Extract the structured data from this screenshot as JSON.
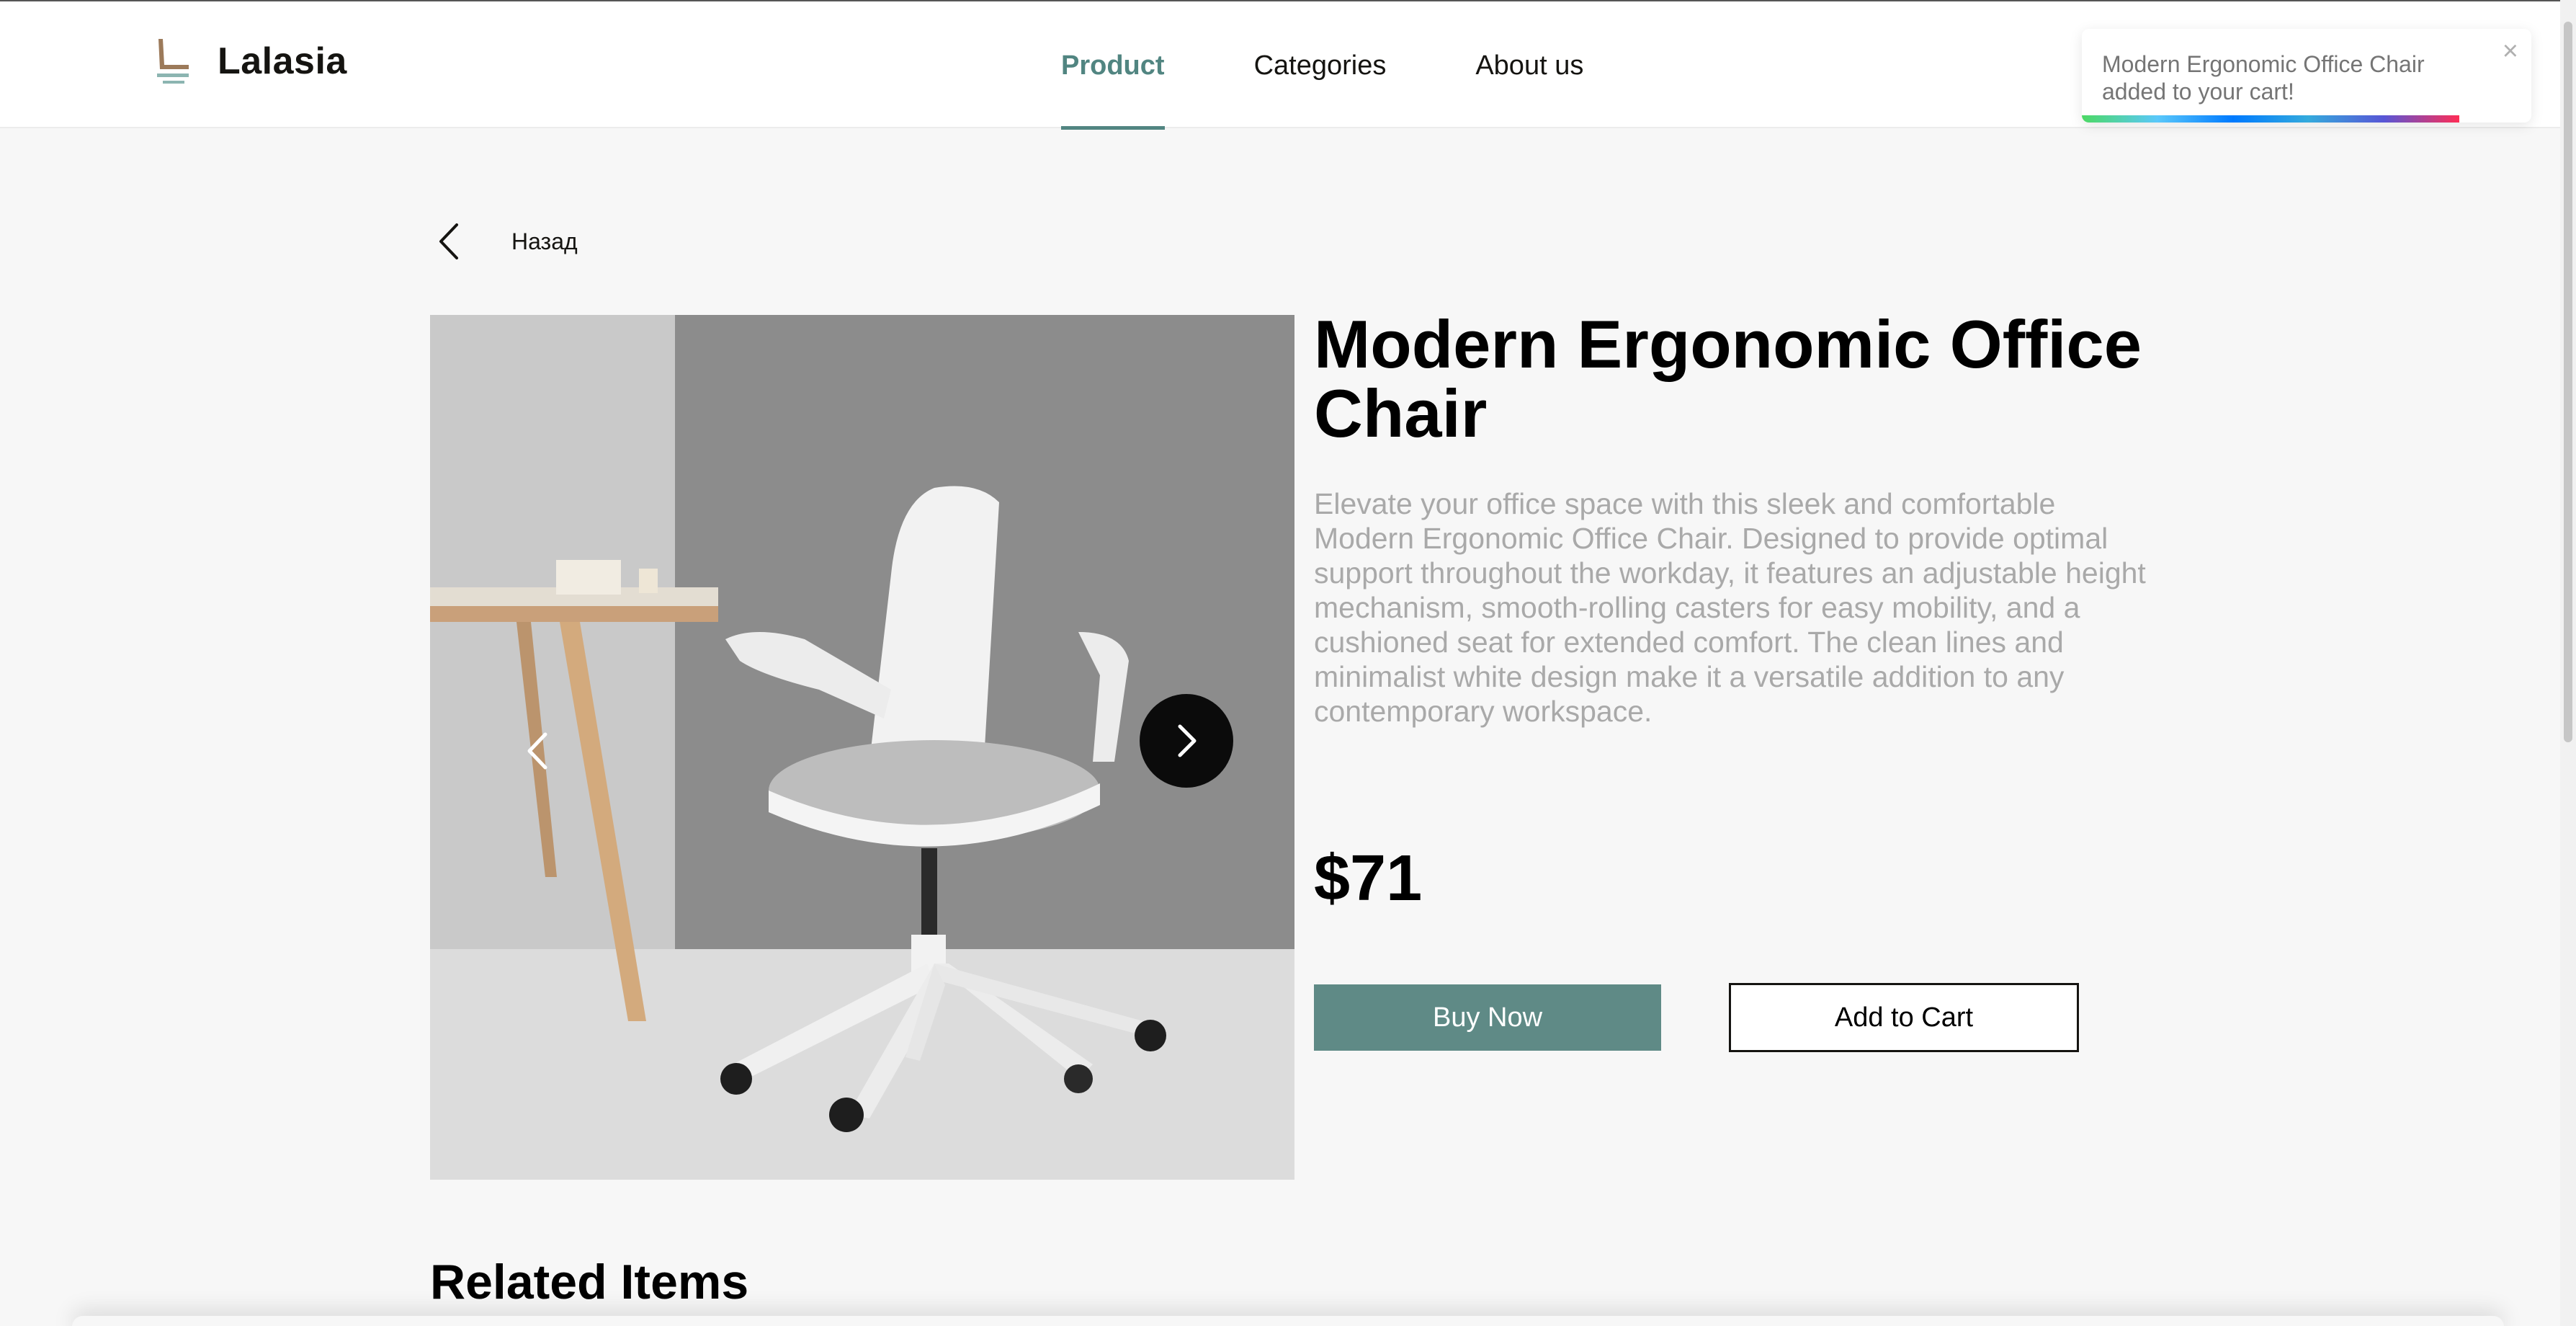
{
  "brand": {
    "name": "Lalasia"
  },
  "nav": {
    "items": [
      {
        "label": "Product",
        "active": true
      },
      {
        "label": "Categories",
        "active": false
      },
      {
        "label": "About us",
        "active": false
      }
    ]
  },
  "toast": {
    "message": "Modern Ergonomic Office Chair added to your cart!",
    "close_icon": "close-icon"
  },
  "back": {
    "label": "Назад",
    "icon": "chevron-left-icon"
  },
  "product": {
    "title": "Modern Ergonomic Office Chair",
    "description": "Elevate your office space with this sleek and comfortable Modern Ergonomic Office Chair. Designed to provide optimal support throughout the workday, it features an adjustable height mechanism, smooth-rolling casters for easy mobility, and a cushioned seat for extended comfort. The clean lines and minimalist white design make it a versatile addition to any contemporary workspace.",
    "price": "$71",
    "buy_label": "Buy Now",
    "cart_label": "Add to Cart"
  },
  "gallery": {
    "prev_icon": "chevron-left-icon",
    "next_icon": "chevron-right-icon"
  },
  "related": {
    "title": "Related Items"
  },
  "colors": {
    "accent": "#518581",
    "button": "#5f8a86",
    "text": "#151411",
    "muted": "#a9a9a9"
  }
}
